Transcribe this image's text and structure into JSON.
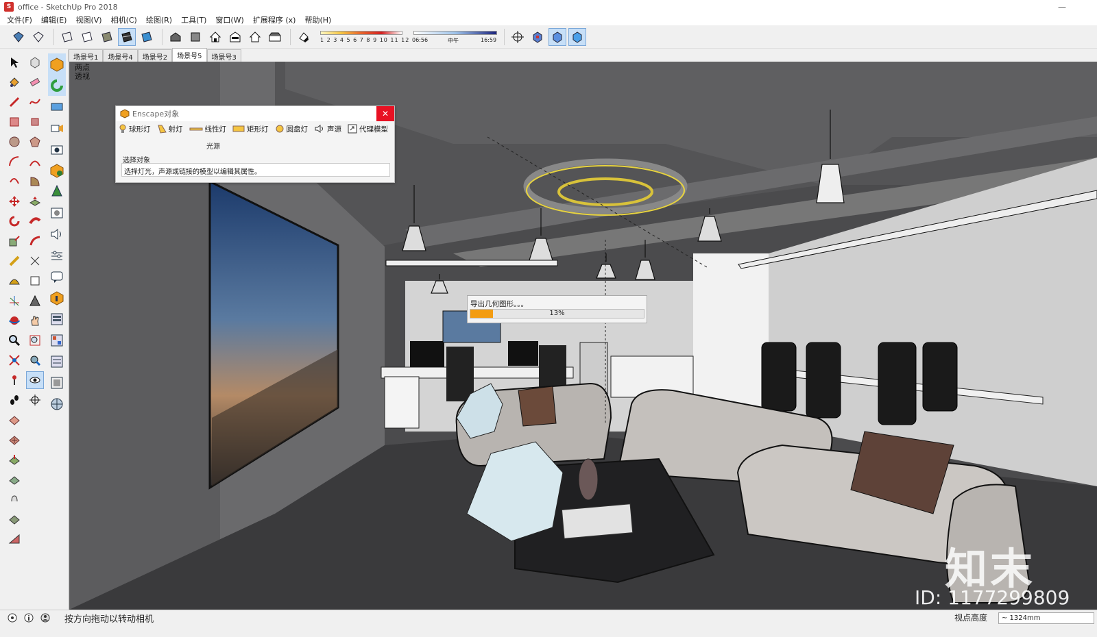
{
  "titlebar": {
    "app_icon": "S",
    "title": "office - SketchUp Pro 2018",
    "minimize": "—"
  },
  "menu": [
    "文件(F)",
    "编辑(E)",
    "视图(V)",
    "相机(C)",
    "绘图(R)",
    "工具(T)",
    "窗口(W)",
    "扩展程序 (x)",
    "帮助(H)"
  ],
  "toolbar": {
    "shadow_scale": "1 2 3 4 5 6 7 8 9 10 11 12",
    "time_start": "06:56",
    "time_mid": "中午",
    "time_end": "16:59"
  },
  "scenes": [
    "场景号1",
    "场景号4",
    "场景号2",
    "场景号5",
    "场景号3"
  ],
  "active_scene_index": 3,
  "viewport": {
    "label": "两点\n透视"
  },
  "enscape": {
    "title": "Enscape对象",
    "close": "✕",
    "tools": [
      "球形灯",
      "射灯",
      "线性灯",
      "矩形灯",
      "圆盘灯",
      "声源",
      "代理模型"
    ],
    "group_label": "光源",
    "section": "选择对象",
    "description": "选择灯光，声源或链接的模型以编辑其属性。"
  },
  "progress": {
    "text": "导出几何图形。。。",
    "percent_label": "13%",
    "percent": 13,
    "color": "#f39c12"
  },
  "watermark": {
    "logo": "知末",
    "id": "ID: 1177299809"
  },
  "status": {
    "message": "按方向拖动以转动相机",
    "measure_label": "视点高度",
    "measure_value": "~ 1324mm"
  }
}
